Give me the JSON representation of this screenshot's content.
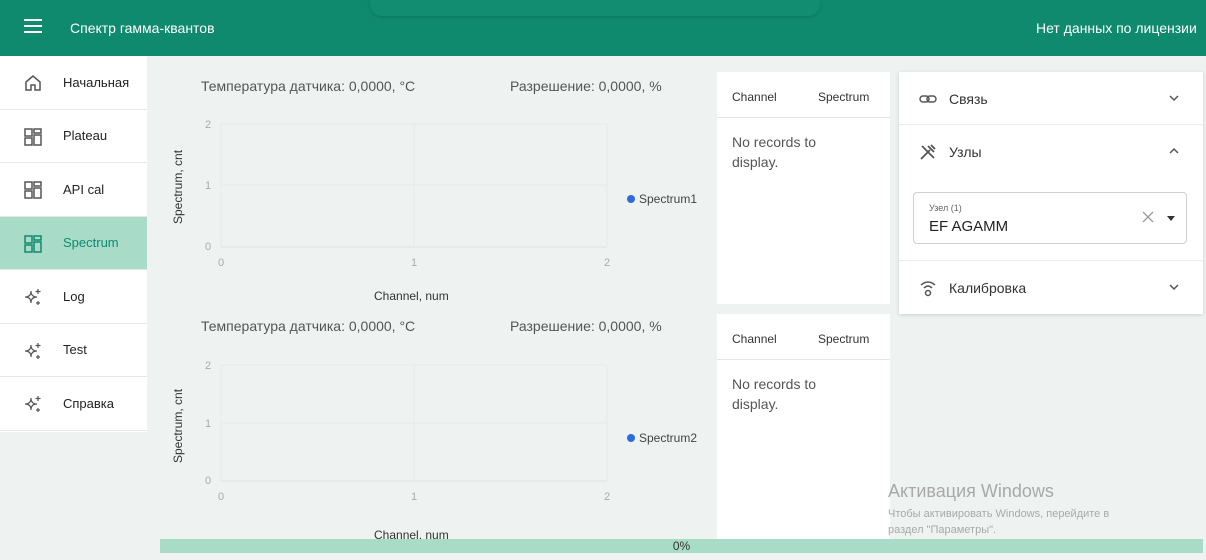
{
  "header": {
    "app_title": "Спектр гамма-квантов",
    "license": "Нет данных по лицензии"
  },
  "sidebar": {
    "items": [
      {
        "label": "Начальная",
        "icon": "home-icon"
      },
      {
        "label": "Plateau",
        "icon": "dashboard-icon"
      },
      {
        "label": "API cal",
        "icon": "dashboard-icon"
      },
      {
        "label": "Spectrum",
        "icon": "dashboard-icon",
        "active": true
      },
      {
        "label": "Log",
        "icon": "sparkle-icon"
      },
      {
        "label": "Test",
        "icon": "sparkle-icon"
      },
      {
        "label": "Справка",
        "icon": "sparkle-icon"
      }
    ]
  },
  "charts": [
    {
      "temp": "Температура датчика: 0,0000, °C",
      "res": "Разрешение: 0,0000, %",
      "ylabel": "Spectrum, cnt",
      "xlabel": "Channel, num",
      "legend": "Spectrum1",
      "yticks": [
        "0",
        "1",
        "2"
      ],
      "xticks": [
        "0",
        "1",
        "2"
      ]
    },
    {
      "temp": "Температура датчика: 0,0000, °C",
      "res": "Разрешение: 0,0000, %",
      "ylabel": "Spectrum, cnt",
      "xlabel": "Channel, num",
      "legend": "Spectrum2",
      "yticks": [
        "0",
        "1",
        "2"
      ],
      "xticks": [
        "0",
        "1",
        "2"
      ]
    }
  ],
  "tables": [
    {
      "col1": "Channel",
      "col2": "Spectrum",
      "empty": "No records to display."
    },
    {
      "col1": "Channel",
      "col2": "Spectrum",
      "empty": "No records to display."
    }
  ],
  "accordion": {
    "link": {
      "label": "Связь",
      "icon": "link-icon"
    },
    "nodes": {
      "label": "Узлы",
      "icon": "tools-icon"
    },
    "node_select": {
      "label": "Узел (1)",
      "value": "EF AGAMM"
    },
    "calibration": {
      "label": "Калибровка",
      "icon": "sensor-icon"
    }
  },
  "progress": {
    "text": "0%",
    "value": 0
  },
  "watermark": {
    "title": "Активация Windows",
    "line1": "Чтобы активировать Windows, перейдите в",
    "line2": "раздел \"Параметры\"."
  },
  "colors": {
    "accent": "#0f8a6e",
    "active_bg": "#a8dcc9",
    "series": "#2d6be0"
  }
}
